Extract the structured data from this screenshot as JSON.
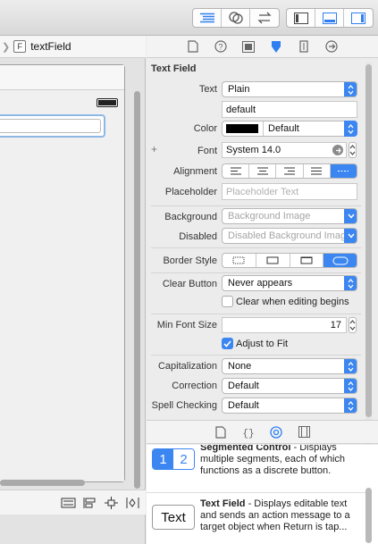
{
  "colors": {
    "accent": "#3b86f1",
    "disabled_accent": "#80b2f4"
  },
  "toolbar": {
    "editor_icons": [
      "standard-editor-icon",
      "assistant-editor-icon",
      "version-editor-icon"
    ],
    "view_icons": [
      "navigator-panel-icon",
      "debug-area-icon",
      "utilities-panel-icon"
    ]
  },
  "jumpbar": {
    "badge": "F",
    "label": "textField"
  },
  "inspector": {
    "tabs": [
      "file-inspector-icon",
      "quick-help-icon",
      "identity-inspector-icon",
      "attributes-inspector-icon",
      "size-inspector-icon",
      "connections-inspector-icon"
    ],
    "section_title": "Text Field",
    "text": {
      "label": "Text",
      "value": "Plain"
    },
    "text_value": "default",
    "color": {
      "label": "Color",
      "value": "Default"
    },
    "font": {
      "label": "Font",
      "value": "System 14.0"
    },
    "alignment": {
      "label": "Alignment",
      "options": [
        "left",
        "center",
        "right",
        "justified",
        "natural"
      ],
      "selected": "natural"
    },
    "placeholder": {
      "label": "Placeholder",
      "placeholder": "Placeholder Text"
    },
    "background": {
      "label": "Background",
      "placeholder": "Background Image"
    },
    "disabled": {
      "label": "Disabled",
      "placeholder": "Disabled Background Image"
    },
    "border_style": {
      "label": "Border Style",
      "options": [
        "none",
        "line",
        "bezel",
        "rounded"
      ],
      "selected": "rounded"
    },
    "clear_button": {
      "label": "Clear Button",
      "value": "Never appears"
    },
    "clear_when_editing": {
      "label": "Clear when editing begins",
      "checked": false
    },
    "min_font_size": {
      "label": "Min Font Size",
      "value": "17"
    },
    "adjust_to_fit": {
      "label": "Adjust to Fit",
      "checked": true
    },
    "capitalization": {
      "label": "Capitalization",
      "value": "None"
    },
    "correction": {
      "label": "Correction",
      "value": "Default"
    },
    "spell_checking": {
      "label": "Spell Checking",
      "value": "Default"
    }
  },
  "library": {
    "tabs": [
      "file-template-icon",
      "code-snippet-icon",
      "object-library-icon",
      "media-library-icon"
    ],
    "items": [
      {
        "icon_text_a": "1",
        "icon_text_b": "2",
        "title": "Segmented Control",
        "desc": " - Displays multiple segments, each of which functions as a discrete button."
      },
      {
        "icon_text": "Text",
        "title": "Text Field",
        "desc": " - Displays editable text and sends an action message to a target object when Return is tap..."
      }
    ]
  }
}
